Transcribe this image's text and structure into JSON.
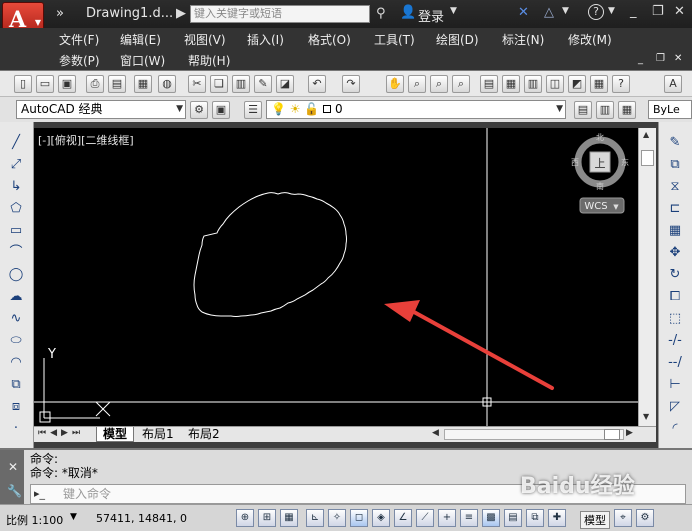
{
  "titlebar": {
    "doc_title": "Drawing1.d...",
    "search_placeholder": "键入关键字或短语",
    "login": "登录",
    "nav_glyph": "»",
    "app_logo": "A"
  },
  "menus": {
    "row1": [
      "文件(F)",
      "编辑(E)",
      "视图(V)",
      "插入(I)",
      "格式(O)",
      "工具(T)",
      "绘图(D)",
      "标注(N)",
      "修改(M)"
    ],
    "row2": [
      "参数(P)",
      "窗口(W)",
      "帮助(H)"
    ]
  },
  "toolbar2": {
    "workspace": "AutoCAD 经典",
    "layer_value": "0",
    "bylayer": "ByLe"
  },
  "viewport": {
    "label": "[-][俯视][二维线框]",
    "compass": {
      "north": "北",
      "south": "南",
      "east": "东",
      "west": "西",
      "top": "上"
    },
    "wcs": "WCS",
    "ucs_y": "Y"
  },
  "tabs": [
    "模型",
    "布局1",
    "布局2"
  ],
  "command": {
    "history": [
      "命令:",
      "命令: *取消*"
    ],
    "input_placeholder": "键入命令"
  },
  "status": {
    "scale": "比例 1:100",
    "coords": "57411, 14841, 0",
    "model": "模型"
  },
  "watermark": "Baidu经验",
  "colors": {
    "canvas": "#000000",
    "arrow": "#e8403a",
    "cloud_line": "#ffffff"
  }
}
